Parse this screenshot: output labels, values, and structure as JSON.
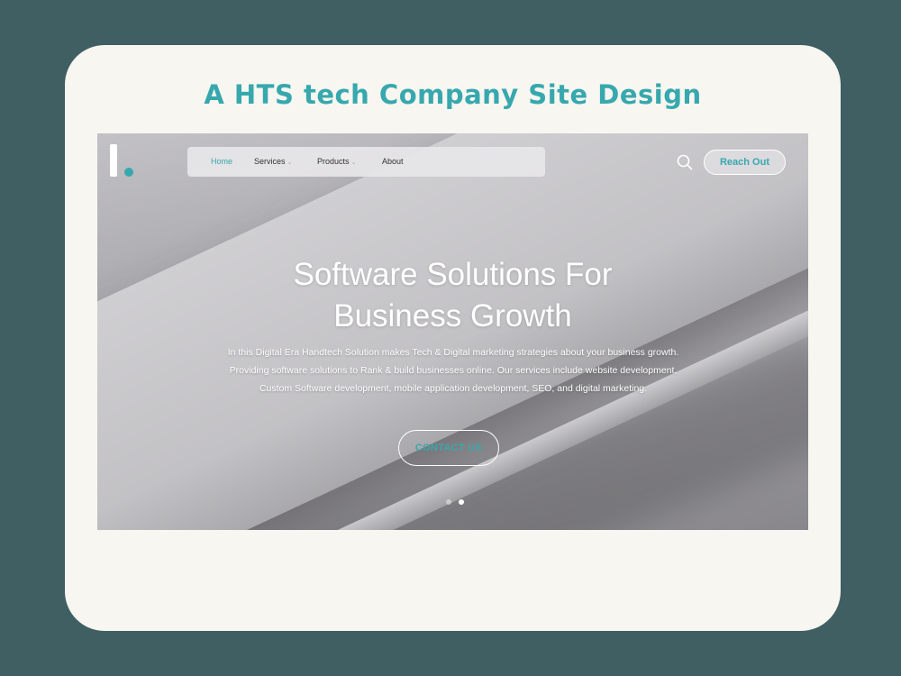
{
  "card": {
    "title": "A HTS tech Company Site Design"
  },
  "nav": {
    "items": [
      {
        "label": "Home",
        "active": true
      },
      {
        "label": "Services",
        "active": false
      },
      {
        "label": "Products",
        "active": false
      },
      {
        "label": "About",
        "active": false
      }
    ],
    "reach_out_label": "Reach Out"
  },
  "hero": {
    "title_line1": "Software Solutions For",
    "title_line2": "Business Growth",
    "description": "In this Digital Era Handtech Solution makes Tech & Digital marketing strategies about your business growth. Providing software solutions to Rank & build businesses online. Our services include website development, Custom Software development, mobile application development, SEO, and digital marketing.",
    "cta_label": "CONTACT US"
  },
  "slider": {
    "slide_count": 2,
    "active_index": 1
  },
  "colors": {
    "accent": "#37a8ad",
    "background": "#3f5f63",
    "card": "#f7f6f1"
  }
}
